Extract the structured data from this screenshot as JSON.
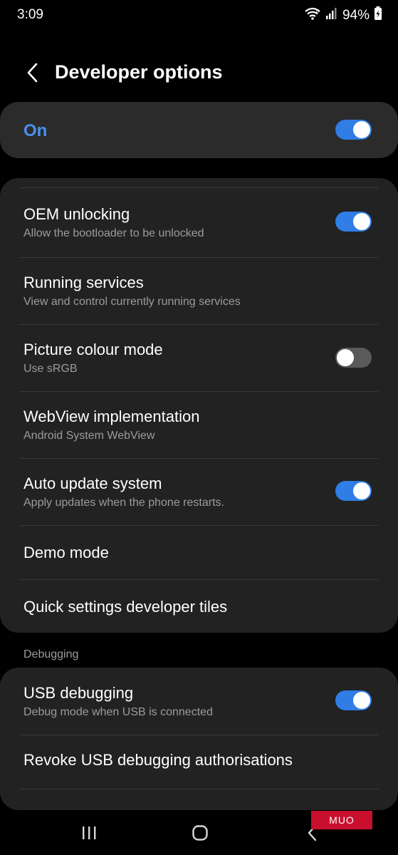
{
  "status_bar": {
    "time": "3:09",
    "battery": "94%",
    "icons": [
      "wifi-6-icon",
      "signal-icon",
      "battery-charging-icon"
    ]
  },
  "header": {
    "title": "Developer options",
    "back_icon": "chevron-left-icon"
  },
  "master_switch": {
    "label": "On",
    "state": true,
    "accent_color": "#2f7de5"
  },
  "settings": [
    {
      "title": "OEM unlocking",
      "subtitle": "Allow the bootloader to be unlocked",
      "toggle": true
    },
    {
      "title": "Running services",
      "subtitle": "View and control currently running services",
      "toggle": null
    },
    {
      "title": "Picture colour mode",
      "subtitle": "Use sRGB",
      "toggle": false
    },
    {
      "title": "WebView implementation",
      "subtitle": "Android System WebView",
      "toggle": null
    },
    {
      "title": "Auto update system",
      "subtitle": "Apply updates when the phone restarts.",
      "toggle": true
    },
    {
      "title": "Demo mode",
      "subtitle": "",
      "toggle": null
    },
    {
      "title": "Quick settings developer tiles",
      "subtitle": "",
      "toggle": null
    }
  ],
  "debugging": {
    "section_label": "Debugging",
    "items": [
      {
        "title": "USB debugging",
        "subtitle": "Debug mode when USB is connected",
        "toggle": true
      },
      {
        "title": "Revoke USB debugging authorisations",
        "subtitle": "",
        "toggle": null
      }
    ]
  },
  "nav_bar": {
    "icons": [
      "recents-icon",
      "home-icon",
      "back-icon"
    ]
  },
  "watermark": "MUO"
}
